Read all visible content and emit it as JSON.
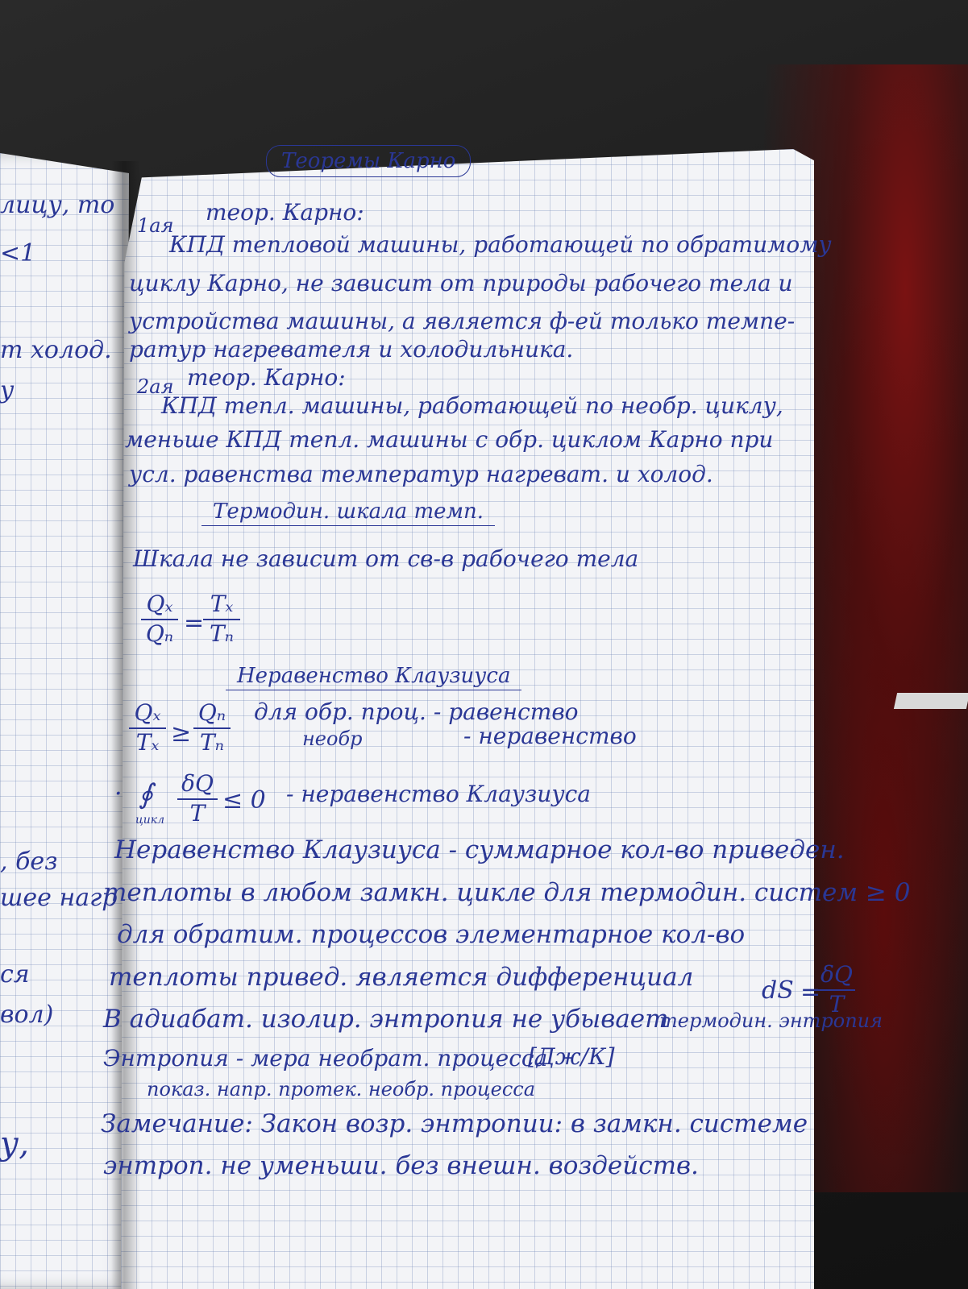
{
  "left_page": {
    "fragments": [
      "лицу, то",
      "<1",
      "т холод.",
      "у",
      ", без",
      "шее нагр",
      "ся",
      "вол)",
      "у,"
    ]
  },
  "title": "Теоремы Карно",
  "theorem1": {
    "number": "1ая",
    "label": "теор. Карно:",
    "lines": [
      "КПД тепловой машины, работающей по обратимому",
      "циклу Карно, не зависит от природы рабочего тела и",
      "устройства машины, а является ф-ей только темпе-",
      "ратур нагревателя и холодильника."
    ]
  },
  "theorem2": {
    "number": "2ая",
    "label": "теор. Карно:",
    "lines": [
      "КПД тепл. машины, работающей по необр. циклу,",
      "меньше КПД тепл. машины с обр. циклом Карно при",
      "усл. равенства температур нагреват. и холод."
    ]
  },
  "thermo_scale": {
    "heading": "Термодин. шкала темп.",
    "statement": "Шкала не зависит от св-в рабочего тела",
    "formula": {
      "lhs_num": "Qₓ",
      "lhs_den": "Qₙ",
      "eq": "=",
      "rhs_num": "Tₓ",
      "rhs_den": "Tₙ"
    }
  },
  "clausius": {
    "heading": "Неравенство Клаузиуса",
    "inequality": {
      "lhs_num": "Qₓ",
      "lhs_den": "Tₓ",
      "op": "≥",
      "rhs_num": "Qₙ",
      "rhs_den": "Tₙ"
    },
    "case1": "для обр. проц. - равенство",
    "case2_word": "необр",
    "case2": "- неравенство",
    "integral": {
      "bullet": "·",
      "sign": "∮",
      "sub": "цикл",
      "num": "δQ",
      "den": "T",
      "tail": "≤ 0",
      "label": "- неравенство Клаузиуса"
    }
  },
  "definition": {
    "lines": [
      "Неравенство Клаузиуса - суммарное кол-во приведен.",
      "теплоты в любом замкн. цикле для термодин. систем ≥ 0",
      "для обратим. процессов элементарное кол-во",
      "теплоты привед. является дифференциал"
    ],
    "entropy_formula": {
      "lhs": "dS",
      "eq": "=",
      "num": "δQ",
      "den": "T"
    },
    "adiabatic": "В адиабат. изолир. энтропия не убывает",
    "adiabatic_tail": "термодин. энтропия",
    "measure": "Энтропия - мера необрат. процесса",
    "unit": "[Дж/К]",
    "direction": "показ. напр. протек. необр. процесса"
  },
  "remark": {
    "lines": [
      "Замечание: Закон возр. энтропии: в замкн. системе",
      "энтроп. не уменьши. без внешн. воздейств."
    ]
  }
}
